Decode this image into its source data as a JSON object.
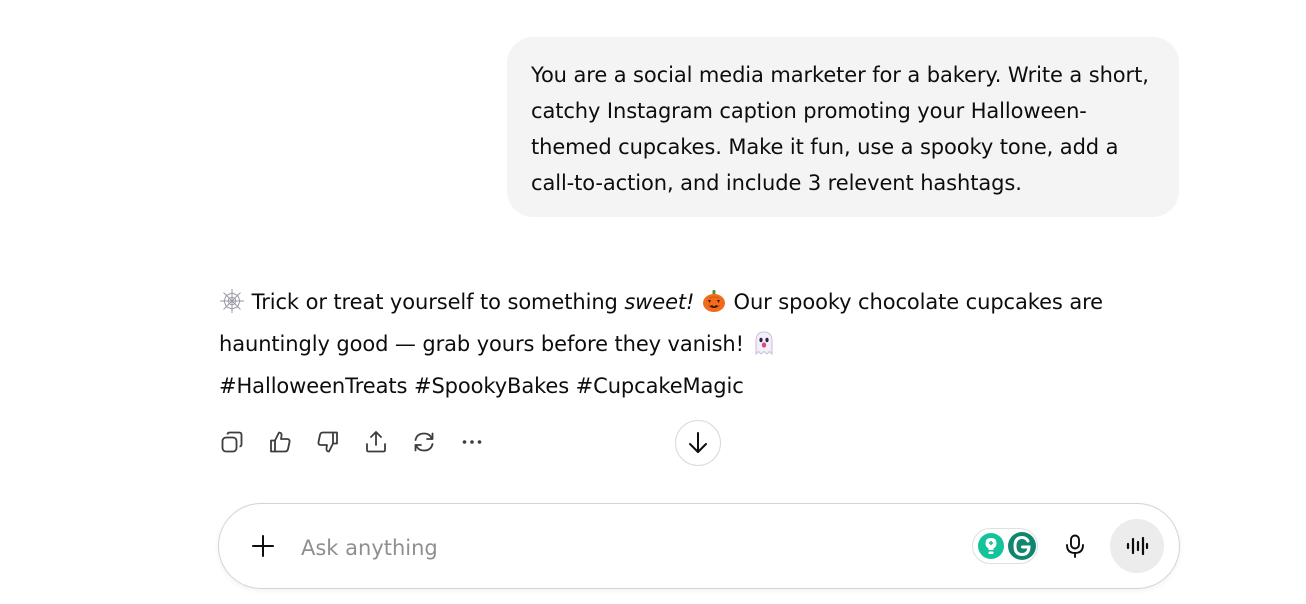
{
  "conversation": {
    "user_message": "You are a social media marketer for a bakery. Write a short, catchy Instagram caption promoting your Halloween-themed cupcakes. Make it fun, use a spooky tone, add a call-to-action, and include 3 relevent hashtags.",
    "assistant": {
      "line1_a": "Trick or treat yourself to something ",
      "line1_em": "sweet!",
      "line1_b": "Our spooky chocolate cupcakes are hauntingly good — grab yours before they vanish!",
      "hashtags": "#HalloweenTreats #SpookyBakes #CupcakeMagic",
      "emoji_icons": [
        "spider-web-icon",
        "jack-o-lantern-icon",
        "ghost-icon"
      ]
    }
  },
  "actions": [
    "copy-icon",
    "thumbs-up-icon",
    "thumbs-down-icon",
    "share-icon",
    "regenerate-icon",
    "more-icon"
  ],
  "composer": {
    "placeholder": "Ask anything",
    "icons": [
      "plus-icon",
      "grammarly-icon",
      "microphone-icon",
      "voice-mode-icon"
    ]
  },
  "colors": {
    "user_bubble": "#f4f4f4",
    "grammarly_green": "#15c39a",
    "grammarly_dark": "#11866f",
    "voice_button_bg": "#ececec"
  }
}
